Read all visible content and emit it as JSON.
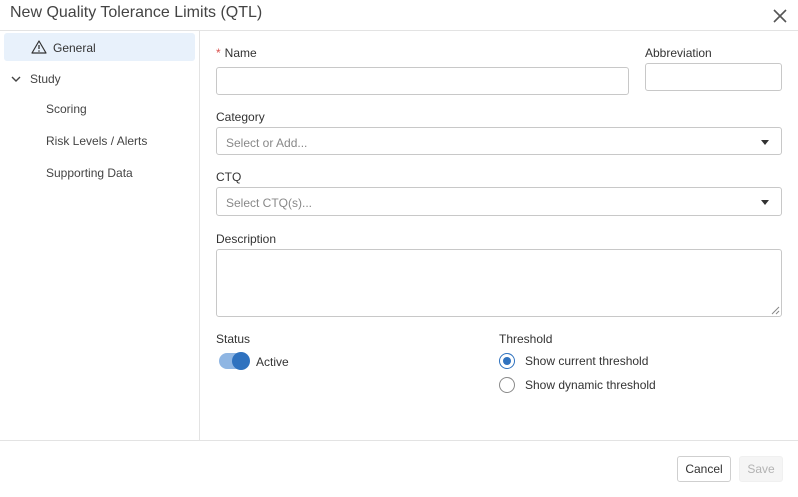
{
  "dialog": {
    "title": "New Quality Tolerance Limits (QTL)"
  },
  "sidebar": {
    "general": "General",
    "study": "Study",
    "sub_items": [
      "Scoring",
      "Risk Levels / Alerts",
      "Supporting Data"
    ]
  },
  "form": {
    "name": {
      "required_mark": "*",
      "label": "Name",
      "value": ""
    },
    "abbreviation": {
      "label": "Abbreviation",
      "value": ""
    },
    "category": {
      "label": "Category",
      "placeholder": "Select or Add..."
    },
    "ctq": {
      "label": "CTQ",
      "placeholder": "Select CTQ(s)..."
    },
    "description": {
      "label": "Description",
      "value": ""
    },
    "status": {
      "label": "Status",
      "toggle_label": "Active",
      "on": true
    },
    "threshold": {
      "label": "Threshold",
      "options": [
        "Show current threshold",
        "Show dynamic threshold"
      ],
      "selected_index": 0
    }
  },
  "footer": {
    "cancel": "Cancel",
    "save": "Save"
  },
  "colors": {
    "accent": "#2f72bf",
    "selected_nav_bg": "#e8f1fb",
    "required": "#d9534f"
  }
}
